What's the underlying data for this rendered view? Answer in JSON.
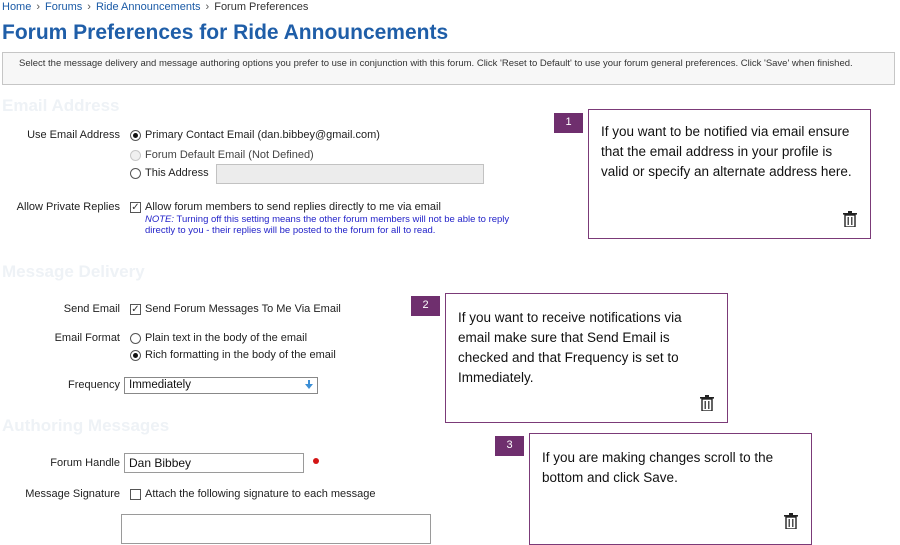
{
  "breadcrumb": {
    "items": [
      "Home",
      "Forums",
      "Ride Announcements",
      "Forum Preferences"
    ],
    "separator": "›"
  },
  "page": {
    "title": "Forum Preferences for Ride Announcements",
    "intro": "Select the message delivery and message authoring options you prefer to use in conjunction with this forum. Click 'Reset to Default' to use your forum general preferences. Click 'Save' when finished."
  },
  "email_address": {
    "heading": "Email Address",
    "use_label": "Use Email Address",
    "options": [
      {
        "label": "Primary Contact Email (dan.bibbey@gmail.com)",
        "selected": true,
        "disabled": false
      },
      {
        "label": "Forum Default Email (Not Defined)",
        "selected": false,
        "disabled": true
      },
      {
        "label": "This Address",
        "selected": false,
        "disabled": false
      }
    ],
    "this_address_value": "",
    "private_label": "Allow Private Replies",
    "private_checkbox_label": "Allow forum members to send replies directly to me via email",
    "private_checked": true,
    "note_prefix": "NOTE:",
    "note_line1": "Turning off this setting means the other forum members will not be able to reply",
    "note_line2": "directly to you - their replies will be posted to the forum for all to read."
  },
  "message_delivery": {
    "heading": "Message Delivery",
    "send_label": "Send Email",
    "send_checkbox_label": "Send Forum Messages To Me Via Email",
    "send_checked": true,
    "format_label": "Email Format",
    "format_options": [
      {
        "label": "Plain text in the body of the email",
        "selected": false
      },
      {
        "label": "Rich formatting in the body of the email",
        "selected": true
      }
    ],
    "frequency_label": "Frequency",
    "frequency_value": "Immediately"
  },
  "authoring": {
    "heading": "Authoring Messages",
    "handle_label": "Forum Handle",
    "handle_value": "Dan Bibbey",
    "signature_label": "Message Signature",
    "signature_checkbox_label": "Attach the following signature to each message",
    "signature_checked": false,
    "signature_text": ""
  },
  "tips": [
    {
      "number": "1",
      "text": "If you want to be notified via email ensure that the email address in your profile is valid or specify an alternate address here."
    },
    {
      "number": "2",
      "text": "If you want to receive notifications via email make sure that Send Email is checked and that Frequency is set to Immediately."
    },
    {
      "number": "3",
      "text": "If you are making changes scroll to the bottom and click Save."
    }
  ],
  "colors": {
    "link": "#1a5aa6",
    "title": "#1f5ea8",
    "tip_accent": "#6f2f6e",
    "note": "#2323c9",
    "required": "#d31515"
  }
}
